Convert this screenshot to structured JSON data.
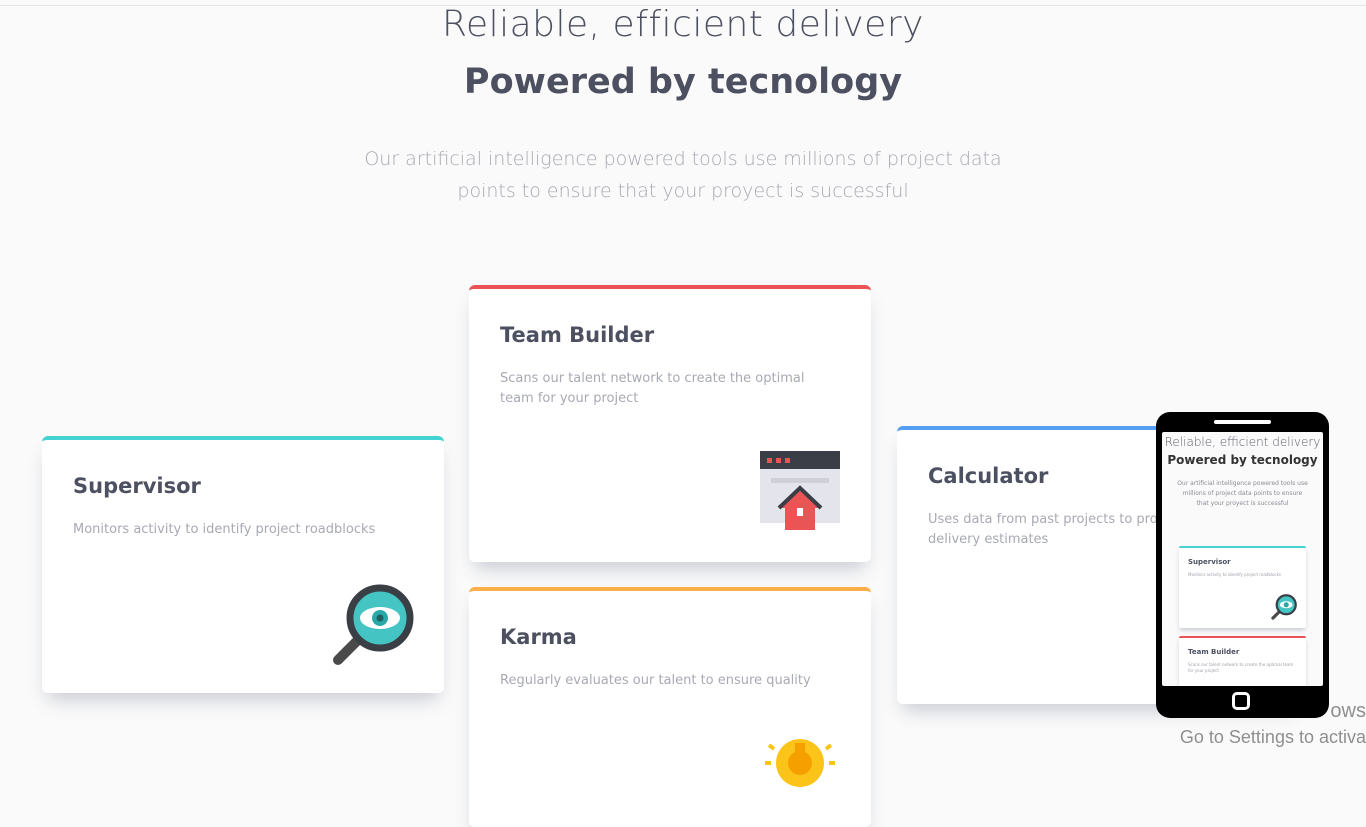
{
  "hero": {
    "heading_light": "Reliable, efficient delivery",
    "heading_bold": "Powered by tecnology",
    "description_line1": "Our artificial intelligence powered tools use millions of project data",
    "description_line2": "points to ensure that your proyect is successful"
  },
  "cards": {
    "supervisor": {
      "title": "Supervisor",
      "description": "Monitors activity to identify project roadblocks",
      "accent": "#44d3d2",
      "icon": "magnifier-eye-icon"
    },
    "team_builder": {
      "title": "Team Builder",
      "description": "Scans our talent network to create the optimal team for your project",
      "accent": "#ea5454",
      "icon": "house-window-icon"
    },
    "karma": {
      "title": "Karma",
      "description": "Regularly evaluates our talent to ensure quality",
      "accent": "#fcae4a",
      "icon": "lightbulb-icon"
    },
    "calculator": {
      "title": "Calculator",
      "description": "Uses data from past projects to pro delivery estimates",
      "accent": "#549ef2",
      "icon": "calculator-icon"
    }
  },
  "phone_preview": {
    "heading_light": "Reliable, efficient delivery",
    "heading_bold": "Powered by tecnology",
    "description": "Our artificial intelligence powered tools use millions of project data points to ensure that your proyect is successful",
    "supervisor_title": "Supervisor",
    "supervisor_description": "Monitors activity to identify project roadblocks",
    "team_builder_title": "Team Builder",
    "team_builder_description": "Scans our talent network to create the optimal team for your project"
  },
  "watermark": {
    "line1": "ows",
    "line2": "Go to Settings to activa"
  }
}
